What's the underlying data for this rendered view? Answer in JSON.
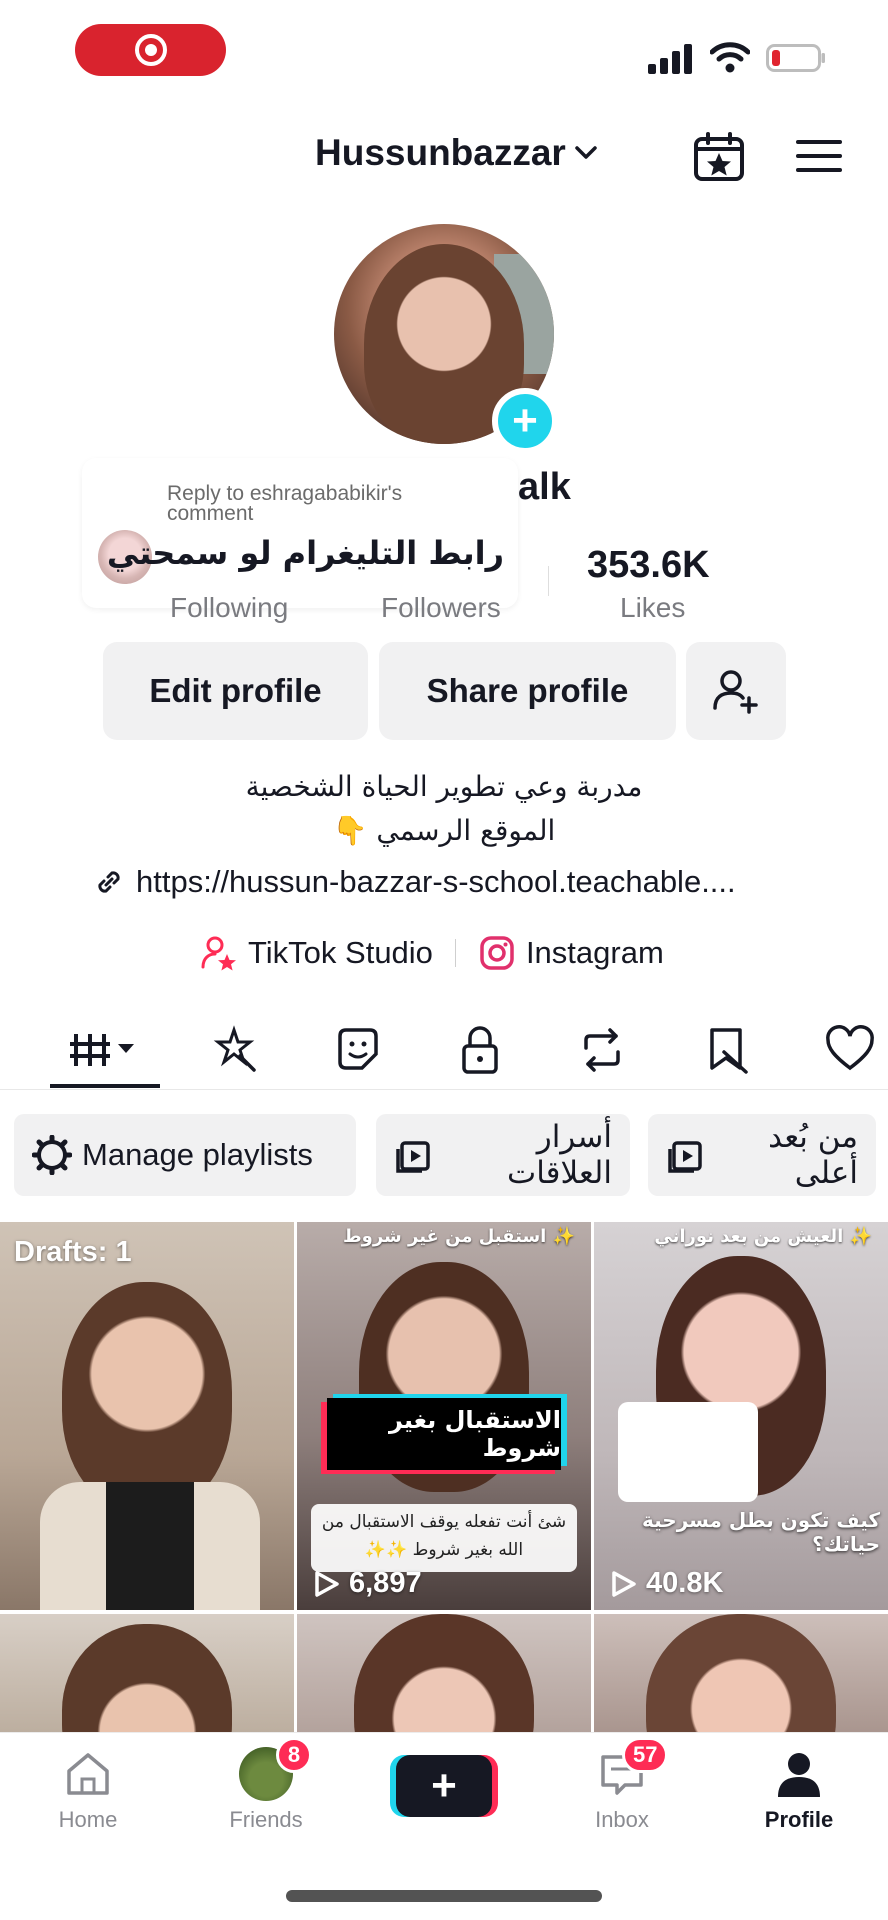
{
  "status_bar": {
    "recording_icon": "screen-record-icon"
  },
  "header": {
    "username": "Hussunbazzar"
  },
  "profile": {
    "name_partial": "alk"
  },
  "reply_overlay": {
    "heading": "Reply to eshragababikir's comment",
    "text": "رابط التليغرام لو سمحتي"
  },
  "stats": {
    "following_label": "Following",
    "followers_label": "Followers",
    "likes_value": "353.6K",
    "likes_label": "Likes"
  },
  "actions": {
    "edit_profile": "Edit profile",
    "share_profile": "Share profile"
  },
  "bio": {
    "line1": "مدربة وعي تطوير الحياة الشخصية",
    "line2": "الموقع الرسمي 👇",
    "link": "https://hussun-bazzar-s-school.teachable...."
  },
  "links": {
    "studio": "TikTok Studio",
    "instagram": "Instagram"
  },
  "playlists": {
    "manage": "Manage playlists",
    "chip1": "أسرار العلاقات",
    "chip2": "من بُعد أعلى"
  },
  "grid": {
    "drafts": "Drafts: 1",
    "video2_top": "✨ استقبل من غير شروط",
    "video2_title": "الاستقبال بغير شروط",
    "video2_sub": "شئ أنت تفعله يوقف الاستقبال من الله بغير شروط ✨✨",
    "video2_views": "6,897",
    "video3_top": "✨ العيش من بعد نوراني",
    "video3_mid": "كيف تكون بطل مسرحية حياتك؟",
    "video3_views": "40.8K"
  },
  "nav": {
    "home": "Home",
    "friends": "Friends",
    "friends_badge": "8",
    "inbox": "Inbox",
    "inbox_badge": "57",
    "profile": "Profile"
  },
  "colors": {
    "brand_red": "#fe2c55",
    "brand_cyan": "#20d5ec",
    "record_red": "#d9232e"
  }
}
